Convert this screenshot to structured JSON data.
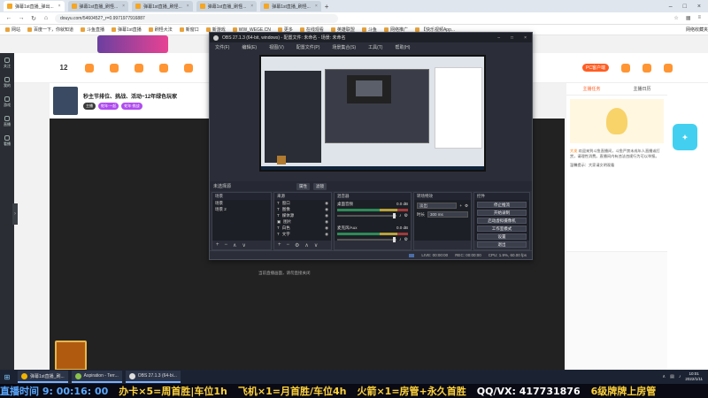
{
  "browser": {
    "tabs": [
      {
        "label": "弹幕1st直播_弹出...",
        "active": true
      },
      {
        "label": "弹幕1st直播_刷怪..."
      },
      {
        "label": "弹幕1st直播_刷怪..."
      },
      {
        "label": "弹幕1st直播_刷怪..."
      },
      {
        "label": "弹幕1st直播_刷怪..."
      }
    ],
    "url": "douyu.com/5460452?_r=0.9971977916887",
    "bookmarks": [
      "网站",
      "百度一下，你就知道",
      "斗鱼直播",
      "弹幕1st直播",
      "刷怪大法",
      "新窗口",
      "新游戏",
      "WW_WEGE.CN",
      "更多",
      "在线观看",
      "英雄联盟",
      "斗鱼",
      "网络推广",
      "【快乐视频App..."
    ],
    "bookmarks_right": "网络收藏夹"
  },
  "page": {
    "top_count": "12",
    "stream_title": "秒主节排位、挑战、活动~12年绿色玩家",
    "tags": [
      "主播",
      "蛇年·一起",
      "蛇年·挑战"
    ],
    "pc_label": "PC客户端",
    "sidebar_tabs": [
      "主播任务",
      "主播日历"
    ],
    "sidebar_text_a": "欢迎来到斗鱼直播间，斗鱼严禁未成年人直播或打赏，请理性消费。直播间内有违法违规行为可以举报。",
    "sidebar_text_b": "温馨提示：大家请文明观看",
    "mascot_label": "大发",
    "rail": [
      "关注",
      "我的",
      "游戏",
      "直播",
      "看播"
    ]
  },
  "obs": {
    "title": "OBS 27.1.3 (64-bit, windows) - 配置文件: 未命名 - 场景: 未命名",
    "menu": [
      "文件(F)",
      "编辑(E)",
      "视图(V)",
      "配置文件(P)",
      "场景集合(S)",
      "工具(T)",
      "帮助(H)"
    ],
    "scene_bar_label": "未选择源",
    "scene_bar_props": "属性",
    "scene_bar_filters": "滤镜",
    "docks": {
      "scenes": {
        "title": "场景",
        "items": [
          "场景",
          "场景 2"
        ]
      },
      "sources": {
        "title": "来源",
        "items": [
          "窗口",
          "图像",
          "媒体源",
          "图片",
          "白色",
          "文字"
        ]
      },
      "mixer": {
        "title": "混音器",
        "channels": [
          {
            "name": "桌面音频",
            "db": "0.0 dB"
          },
          {
            "name": "麦克风/Aux",
            "db": "0.0 dB"
          }
        ]
      },
      "transitions": {
        "title": "转场特效",
        "value": "淡出",
        "duration_label": "时长",
        "duration": "300 ms"
      },
      "controls": {
        "title": "控件",
        "buttons": [
          "停止推流",
          "开始录制",
          "启动虚拟摄像机",
          "工作室模式",
          "设置",
          "退出"
        ]
      }
    },
    "status": {
      "live": "LIVE: 00:00:00",
      "rec": "REC: 00:00:00",
      "cpu": "CPU: 1.9%, 60.00 fps"
    }
  },
  "overlay_note": "当前直播画面，请勿直接关闭",
  "taskbar": {
    "tasks": [
      {
        "label": "弹幕1st直播_刷...",
        "icon": "chrome-icon"
      },
      {
        "label": "Aspiration - Terr...",
        "icon": "game-icon"
      },
      {
        "label": "OBS 27.1.3 (64-bi...",
        "icon": "obs-icon"
      }
    ],
    "time": "10:01",
    "date": "2022/1/11"
  },
  "ticker": {
    "time_label": "直播时间",
    "time_value": "9: 00:16: 00",
    "items": [
      "办卡×5=周首胜|车位1h",
      "飞机×1=月首胜/车位4h",
      "火箭×1=房管+永久首胜",
      "QQ/VX: 417731876",
      "6级牌牌上房管"
    ]
  },
  "colors": {
    "accent": "#ff5d23",
    "ticker_yellow": "#ffd23a",
    "ticker_blue": "#5aa8ff"
  }
}
